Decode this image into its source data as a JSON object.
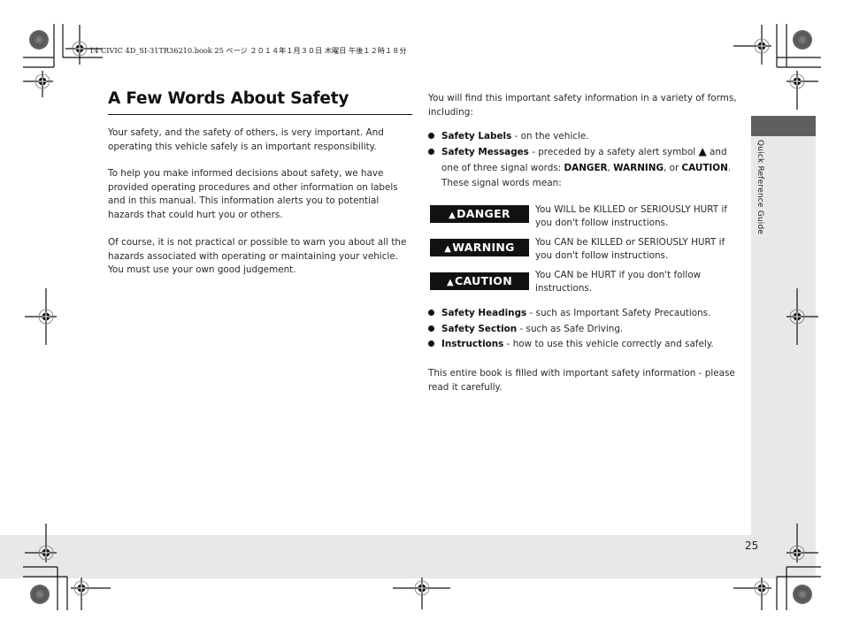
{
  "print_header": "14 CIVIC 4D_SI-31TR36210.book  25 ページ  ２０１４年１月３０日  木曜日  午後１２時１８分",
  "section_tab": {
    "label": "Quick Reference Guide"
  },
  "page_number": "25",
  "title": "A Few Words About Safety",
  "left_paragraphs": [
    "Your safety, and the safety of others, is very important. And operating this vehicle safely is an important responsibility.",
    "To help you make informed decisions about safety, we have provided operating procedures and other information on labels and in this manual. This information alerts you to potential hazards that could hurt you or others.",
    "Of course, it is not practical or possible to warn you about all the hazards associated with operating or maintaining your vehicle. You must use your own good judgement."
  ],
  "right": {
    "intro": "You will find this important safety information in a variety of forms, including:",
    "bullets_top": [
      {
        "bold": "Safety Labels",
        "text": " - on the vehicle."
      },
      {
        "bold": "Safety Messages",
        "text": " - preceded by a safety alert symbol",
        "text_after_symbol": " and",
        "line2_pre": "one of three signal words: ",
        "w1": "DANGER",
        "sep1": ", ",
        "w2": "WARNING",
        "sep2": ", or ",
        "w3": "CAUTION",
        "end": ".",
        "line3": "These signal words mean:"
      }
    ],
    "signal_words": [
      {
        "icon": "alert-triangle",
        "label": "DANGER",
        "desc": "You WILL be KILLED or SERIOUSLY HURT if you don't follow instructions."
      },
      {
        "icon": "alert-triangle",
        "label": "WARNING",
        "desc": "You CAN be KILLED or SERIOUSLY HURT if you don't follow instructions."
      },
      {
        "icon": "alert-triangle",
        "label": "CAUTION",
        "desc": "You CAN be HURT if you don't follow instructions."
      }
    ],
    "bullets_bottom": [
      {
        "bold": "Safety Headings",
        "text": " - such as Important Safety Precautions."
      },
      {
        "bold": "Safety Section",
        "text": " - such as Safe Driving."
      },
      {
        "bold": "Instructions",
        "text": " - how to use this vehicle correctly and safely."
      }
    ],
    "closing": "This entire book is filled with important safety information - please read it carefully."
  },
  "icons": {
    "alert_symbol": "▲"
  }
}
